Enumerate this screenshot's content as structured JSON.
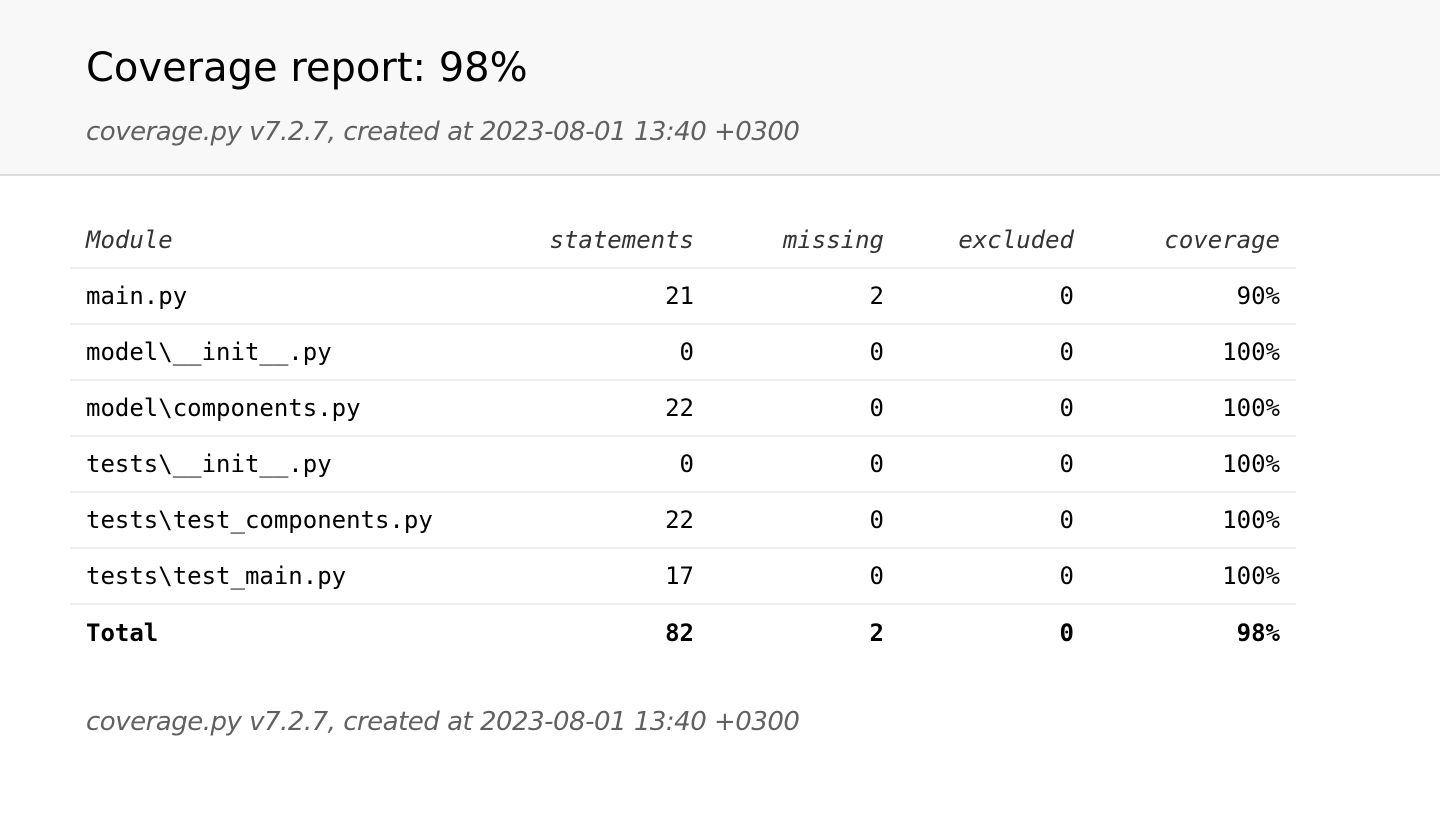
{
  "header": {
    "title": "Coverage report: 98%",
    "meta": "coverage.py v7.2.7, created at 2023-08-01 13:40 +0300"
  },
  "table": {
    "columns": {
      "module": "Module",
      "statements": "statements",
      "missing": "missing",
      "excluded": "excluded",
      "coverage": "coverage"
    },
    "rows": [
      {
        "module": "main.py",
        "statements": "21",
        "missing": "2",
        "excluded": "0",
        "coverage": "90%"
      },
      {
        "module": "model\\__init__.py",
        "statements": "0",
        "missing": "0",
        "excluded": "0",
        "coverage": "100%"
      },
      {
        "module": "model\\components.py",
        "statements": "22",
        "missing": "0",
        "excluded": "0",
        "coverage": "100%"
      },
      {
        "module": "tests\\__init__.py",
        "statements": "0",
        "missing": "0",
        "excluded": "0",
        "coverage": "100%"
      },
      {
        "module": "tests\\test_components.py",
        "statements": "22",
        "missing": "0",
        "excluded": "0",
        "coverage": "100%"
      },
      {
        "module": "tests\\test_main.py",
        "statements": "17",
        "missing": "0",
        "excluded": "0",
        "coverage": "100%"
      }
    ],
    "total": {
      "module": "Total",
      "statements": "82",
      "missing": "2",
      "excluded": "0",
      "coverage": "98%"
    }
  },
  "footer": {
    "meta": "coverage.py v7.2.7, created at 2023-08-01 13:40 +0300"
  }
}
